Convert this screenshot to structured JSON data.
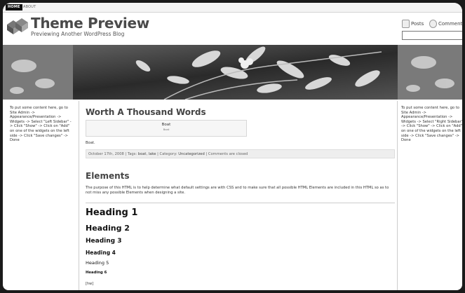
{
  "topnav": {
    "home": "HOME",
    "about": "ABOUT"
  },
  "site": {
    "title": "Theme Preview",
    "tagline": "Previewing Another WordPress Blog"
  },
  "feeds": {
    "posts": "Posts",
    "comments": "Comments"
  },
  "sidebar": {
    "left_text": "To put some content here, go to Site Admin -> Appearance/Presentation -> Widgets -> Select \"Left Sidebar\" -> Click \"Show\" -> Click on \"Add\" on one of the widgets on the left side -> Click \"Save changes\" -> Done",
    "right_text": "To put some content here, go to Site Admin -> Appearance/Presentation -> Widgets -> Select \"Right Sidebar\" -> Click \"Show\" -> Click on \"Add\" on one of the widgets on the left side -> Click \"Save changes\" -> Done"
  },
  "post": {
    "title": "Worth A Thousand Words",
    "caption_title": "Boat",
    "caption_sub": "Boat",
    "text": "Boat.",
    "meta": {
      "date": "October 17th, 2008",
      "tags_label": "Tags:",
      "tag1": "boat",
      "tag2": "lake",
      "category_label": "Category:",
      "category": "Uncategorized",
      "comments": "Comments are closed"
    }
  },
  "elements": {
    "title": "Elements",
    "text": "The purpose of this HTML is to help determine what default settings are with CSS and to make sure that all possible HTML Elements are included in this HTML so as to not miss any possible Elements when designing a site.",
    "h1": "Heading 1",
    "h2": "Heading 2",
    "h3": "Heading 3",
    "h4": "Heading 4",
    "h5": "Heading 5",
    "h6": "Heading 6",
    "hw": "[hw]"
  }
}
